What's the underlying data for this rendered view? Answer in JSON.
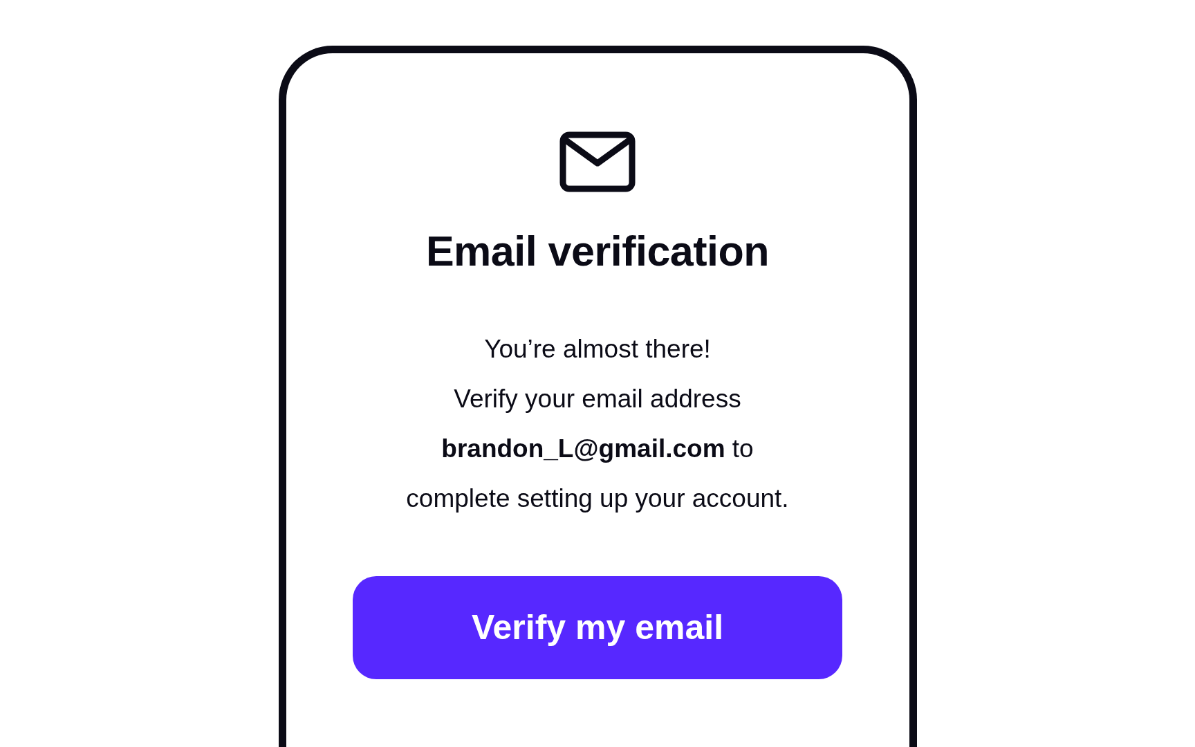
{
  "card": {
    "title": "Email verification",
    "greeting": "You’re almost there!",
    "message": "Verify your email address\n**brandon_L@gmail.com** to\ncomplete setting up your account.",
    "button": "Verify my email"
  }
}
